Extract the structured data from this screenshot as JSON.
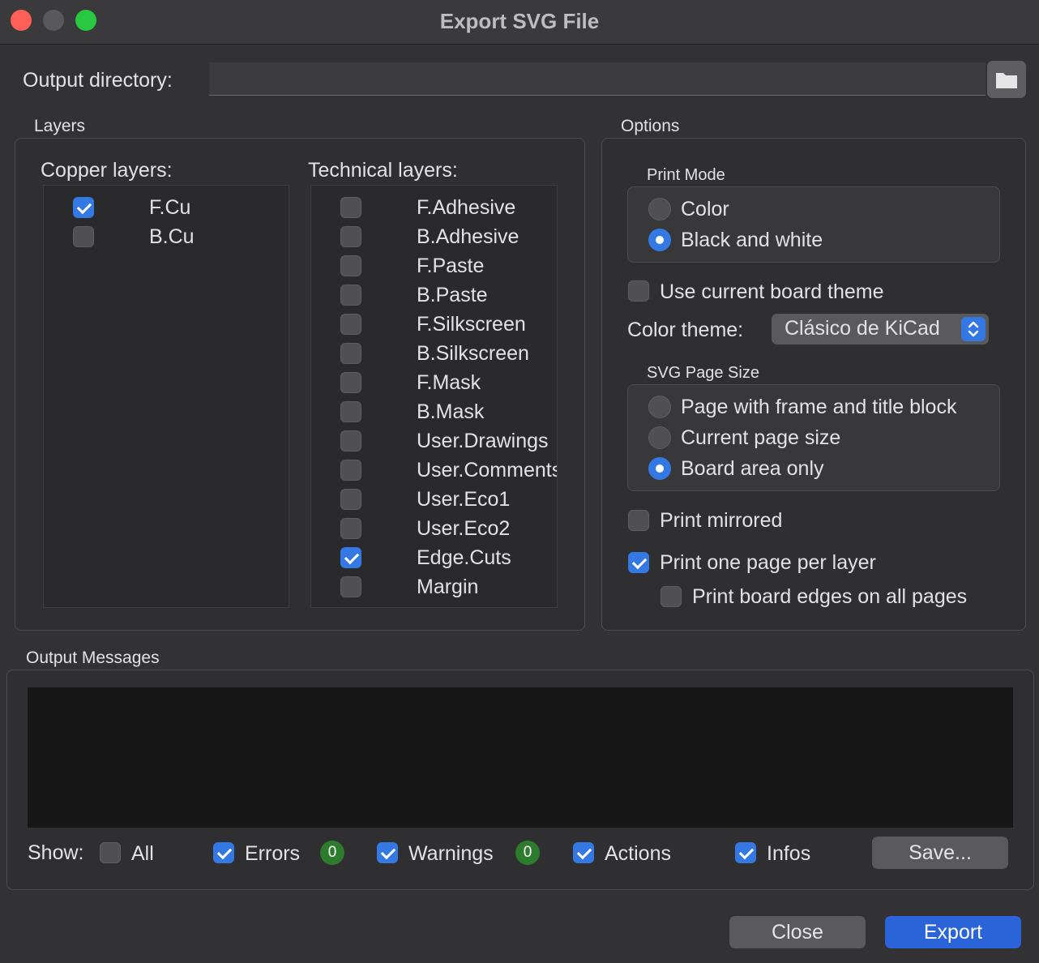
{
  "window": {
    "title": "Export SVG File"
  },
  "output_directory": {
    "label": "Output directory:",
    "value": ""
  },
  "layers": {
    "group_label": "Layers",
    "copper": {
      "label": "Copper layers:",
      "items": [
        {
          "name": "F.Cu",
          "checked": true
        },
        {
          "name": "B.Cu",
          "checked": false
        }
      ]
    },
    "technical": {
      "label": "Technical layers:",
      "items": [
        {
          "name": "F.Adhesive",
          "checked": false
        },
        {
          "name": "B.Adhesive",
          "checked": false
        },
        {
          "name": "F.Paste",
          "checked": false
        },
        {
          "name": "B.Paste",
          "checked": false
        },
        {
          "name": "F.Silkscreen",
          "checked": false
        },
        {
          "name": "B.Silkscreen",
          "checked": false
        },
        {
          "name": "F.Mask",
          "checked": false
        },
        {
          "name": "B.Mask",
          "checked": false
        },
        {
          "name": "User.Drawings",
          "checked": false
        },
        {
          "name": "User.Comments",
          "checked": false
        },
        {
          "name": "User.Eco1",
          "checked": false
        },
        {
          "name": "User.Eco2",
          "checked": false
        },
        {
          "name": "Edge.Cuts",
          "checked": true
        },
        {
          "name": "Margin",
          "checked": false
        }
      ]
    }
  },
  "options": {
    "group_label": "Options",
    "print_mode": {
      "label": "Print Mode",
      "items": [
        {
          "label": "Color",
          "selected": false
        },
        {
          "label": "Black and white",
          "selected": true
        }
      ]
    },
    "use_board_theme": {
      "label": "Use current board theme",
      "checked": false
    },
    "color_theme": {
      "label": "Color theme:",
      "value": "Clásico de KiCad"
    },
    "page_size": {
      "label": "SVG Page Size",
      "items": [
        {
          "label": "Page with frame and title block",
          "selected": false
        },
        {
          "label": "Current page size",
          "selected": false
        },
        {
          "label": "Board area only",
          "selected": true
        }
      ]
    },
    "print_mirrored": {
      "label": "Print mirrored",
      "checked": false
    },
    "one_page_per_layer": {
      "label": "Print one page per layer",
      "checked": true
    },
    "board_edges_all_pages": {
      "label": "Print board edges on all pages",
      "checked": false
    }
  },
  "messages": {
    "group_label": "Output Messages",
    "show_label": "Show:",
    "filters": {
      "all": {
        "label": "All",
        "checked": false
      },
      "errors": {
        "label": "Errors",
        "checked": true,
        "count": "0"
      },
      "warnings": {
        "label": "Warnings",
        "checked": true,
        "count": "0"
      },
      "actions": {
        "label": "Actions",
        "checked": true
      },
      "infos": {
        "label": "Infos",
        "checked": true
      }
    },
    "save_label": "Save..."
  },
  "buttons": {
    "close": "Close",
    "export": "Export"
  },
  "colors": {
    "accent": "#3479e3",
    "badge": "#2d7c2d",
    "background": "#323234"
  }
}
